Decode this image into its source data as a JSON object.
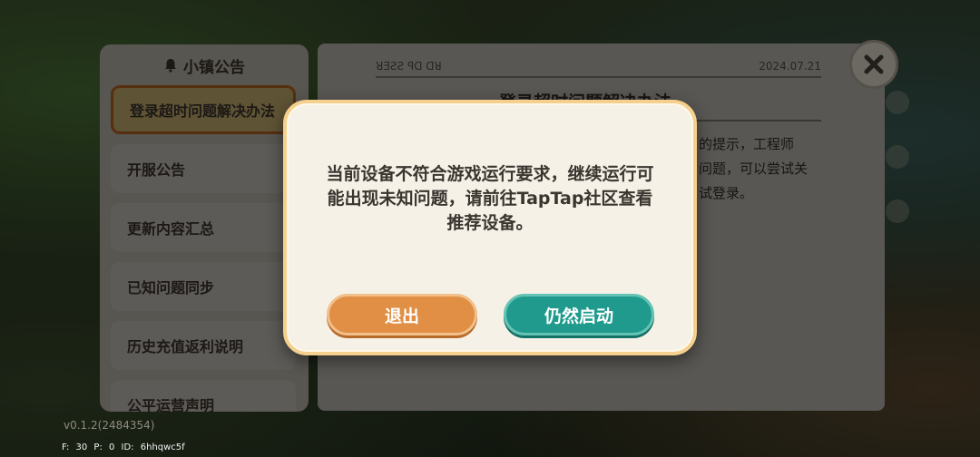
{
  "sidebar": {
    "title": "小镇公告",
    "items": [
      {
        "label": "登录超时问题解决办法",
        "active": true
      },
      {
        "label": "开服公告",
        "active": false
      },
      {
        "label": "更新内容汇总",
        "active": false
      },
      {
        "label": "已知问题同步",
        "active": false
      },
      {
        "label": "历史充值返利说明",
        "active": false
      },
      {
        "label": "公平运营声明",
        "active": false
      }
    ]
  },
  "article": {
    "date": "2024.07.21",
    "title": "登录超时问题解决办法",
    "body_lines": [
      "的提示，工程师",
      "问题，可以尝试关",
      "试登录。"
    ]
  },
  "footer": {
    "version": "v0.1.2(2484354)",
    "stats": "F: 30   P: 0   ID: 6hhqwc5f"
  },
  "dialog": {
    "message": "当前设备不符合游戏运行要求，继续运行可能出现未知问题，请前往TapTap社区查看推荐设备。",
    "exit_label": "退出",
    "start_label": "仍然启动"
  },
  "colors": {
    "exit_button": "#e08f45",
    "start_button": "#1f9a8c",
    "dialog_border": "#f4cf8d"
  },
  "icons": {
    "close": "close-icon",
    "bell": "bell-icon"
  }
}
